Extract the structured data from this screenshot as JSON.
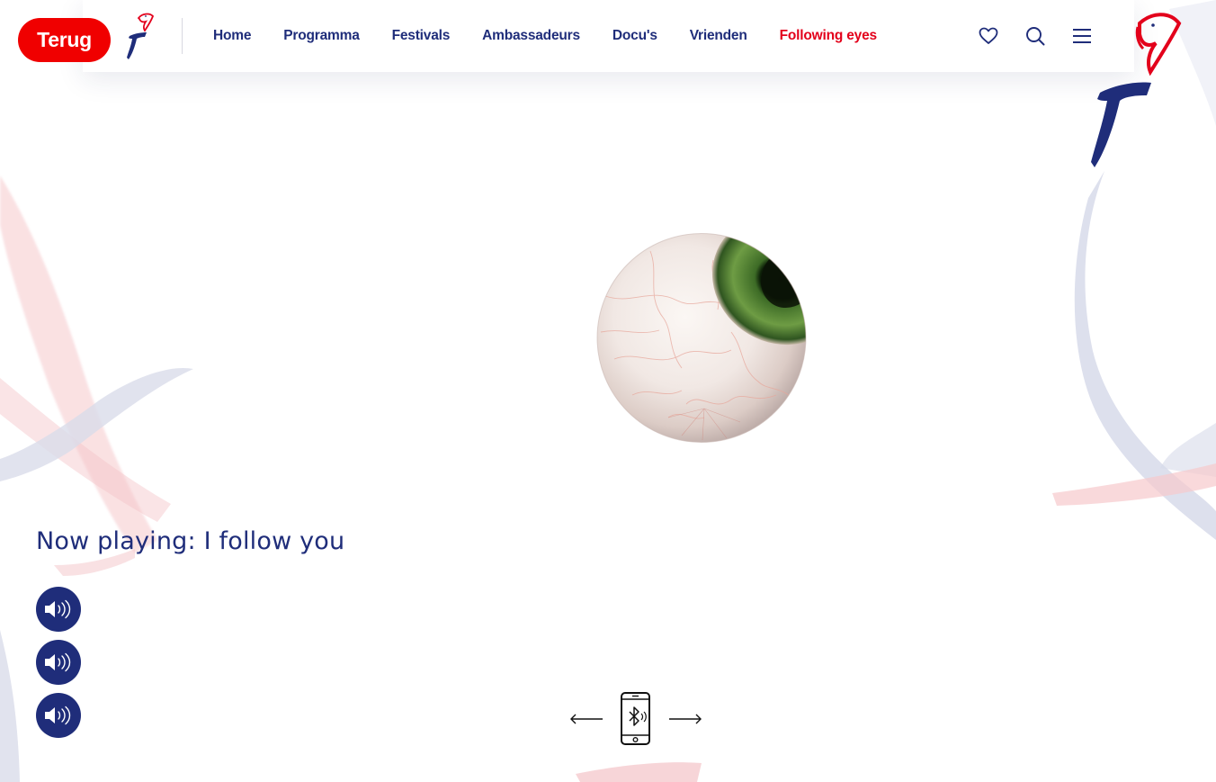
{
  "header": {
    "back_label": "Terug",
    "nav": [
      {
        "label": "Home",
        "active": false
      },
      {
        "label": "Programma",
        "active": false
      },
      {
        "label": "Festivals",
        "active": false
      },
      {
        "label": "Ambassadeurs",
        "active": false
      },
      {
        "label": "Docu's",
        "active": false
      },
      {
        "label": "Vrienden",
        "active": false
      },
      {
        "label": "Following eyes",
        "active": true
      }
    ],
    "icons": [
      "heart-icon",
      "search-icon",
      "menu-icon"
    ]
  },
  "main": {
    "now_playing": "Now playing: I follow you",
    "sound_buttons": [
      "speaker-icon",
      "speaker-icon",
      "speaker-icon"
    ],
    "bluetooth_nav": {
      "prev_icon": "arrow-left-icon",
      "device_icon": "bluetooth-phone-icon",
      "next_icon": "arrow-right-icon"
    }
  },
  "colors": {
    "brand_blue": "#1f2d7a",
    "brand_red": "#e3001b",
    "back_button": "#f00000"
  }
}
